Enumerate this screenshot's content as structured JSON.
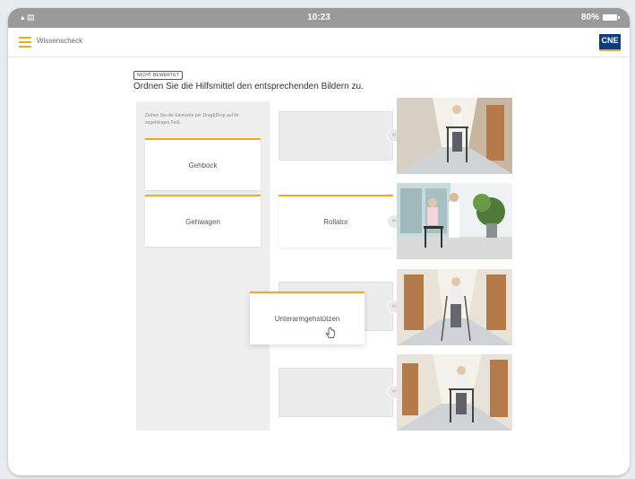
{
  "status_bar": {
    "time": "10:23",
    "battery": "80%",
    "signal_icon": "wifi-icon"
  },
  "header": {
    "title": "Wissenscheck",
    "logo": "CNE",
    "menu_icon": "hamburger-icon"
  },
  "task": {
    "badge": "NICHT BEWERTET",
    "instruction": "Ordnen Sie die Hilfsmittel den entsprechenden Bildern zu."
  },
  "source_panel": {
    "hint": "Ziehen Sie die Elemente per Drag&Drop auf ihr zugehöriges Feld.",
    "cards": [
      {
        "label": "Gehbock"
      },
      {
        "label": "Gehwagen"
      }
    ]
  },
  "targets": [
    {
      "placed": "",
      "photo": "patient-with-walking-frame-hallway"
    },
    {
      "placed": "Rollator",
      "photo": "patient-with-rollator-and-nurse"
    },
    {
      "placed": "",
      "photo": "patient-with-forearm-crutches"
    },
    {
      "placed": "",
      "photo": "patient-with-walker-hallway"
    }
  ],
  "dragging_card": {
    "label": "Unterarmgehstützen"
  },
  "colors": {
    "accent": "#f5a623",
    "brand": "#0f3d7a",
    "status_bar": "#9a9a9a"
  }
}
